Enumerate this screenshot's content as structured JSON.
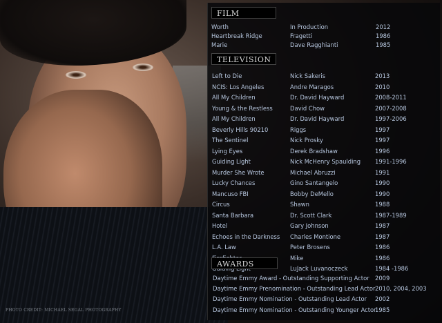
{
  "headings": {
    "film": "FILM",
    "television": "TELEVISION",
    "awards": "AWARDS"
  },
  "film": [
    {
      "title": "Worth",
      "role": "In Production",
      "year": "2012"
    },
    {
      "title": "Heartbreak Ridge",
      "role": "Fragetti",
      "year": "1986"
    },
    {
      "title": "Marie",
      "role": "Dave Ragghianti",
      "year": "1985"
    }
  ],
  "television": [
    {
      "title": "Left to Die",
      "role": "Nick Sakeris",
      "year": "2013"
    },
    {
      "title": "NCIS: Los Angeles",
      "role": "Andre Maragos",
      "year": "2010"
    },
    {
      "title": "All My Children",
      "role": "Dr. David Hayward",
      "year": "2008-2011"
    },
    {
      "title": "Young & the Restless",
      "role": "David Chow",
      "year": "2007-2008"
    },
    {
      "title": "All My Children",
      "role": "Dr. David Hayward",
      "year": "1997-2006"
    },
    {
      "title": "Beverly Hills 90210",
      "role": "Riggs",
      "year": "1997"
    },
    {
      "title": "The Sentinel",
      "role": "Nick Prosky",
      "year": "1997"
    },
    {
      "title": "Lying Eyes",
      "role": "Derek Bradshaw",
      "year": "1996"
    },
    {
      "title": "Guiding Light",
      "role": "Nick McHenry Spaulding",
      "year": "1991-1996"
    },
    {
      "title": "Murder She Wrote",
      "role": "Michael Abruzzi",
      "year": "1991"
    },
    {
      "title": "Lucky Chances",
      "role": "Gino Santangelo",
      "year": "1990"
    },
    {
      "title": "Mancuso FBI",
      "role": "Bobby DeMello",
      "year": "1990"
    },
    {
      "title": "Circus",
      "role": "Shawn",
      "year": "1988"
    },
    {
      "title": "Santa Barbara",
      "role": "Dr. Scott Clark",
      "year": "1987-1989"
    },
    {
      "title": "Hotel",
      "role": "Gary Johnson",
      "year": "1987"
    },
    {
      "title": "Echoes in the Darkness",
      "role": "Charles Montione",
      "year": "1987"
    },
    {
      "title": "L.A. Law",
      "role": "Peter Brosens",
      "year": "1986"
    },
    {
      "title": "Firefighter",
      "role": "Mike",
      "year": "1986"
    },
    {
      "title": "Guiding Light",
      "role": "LuJack Luvanoczeck",
      "year": "1984 -1986"
    }
  ],
  "awards": [
    {
      "award": "Daytime Emmy Award - Outstanding Supporting Actor",
      "year": "2009"
    },
    {
      "award": "Daytime Emmy Prenomination - Outstanding Lead Actor",
      "year": "2010, 2004, 2003"
    },
    {
      "award": "Daytime Emmy Nomination - Outstanding Lead Actor",
      "year": "2002"
    },
    {
      "award": "Daytime Emmy Nomination - Outstanding Younger Actor",
      "year": "1985"
    }
  ],
  "photo_credit": "PHOTO CREDIT: MICHAEL SEGAL PHOTOGRAPHY",
  "colors": {
    "text": "#b8c8e0",
    "heading_bg": "#000000"
  }
}
